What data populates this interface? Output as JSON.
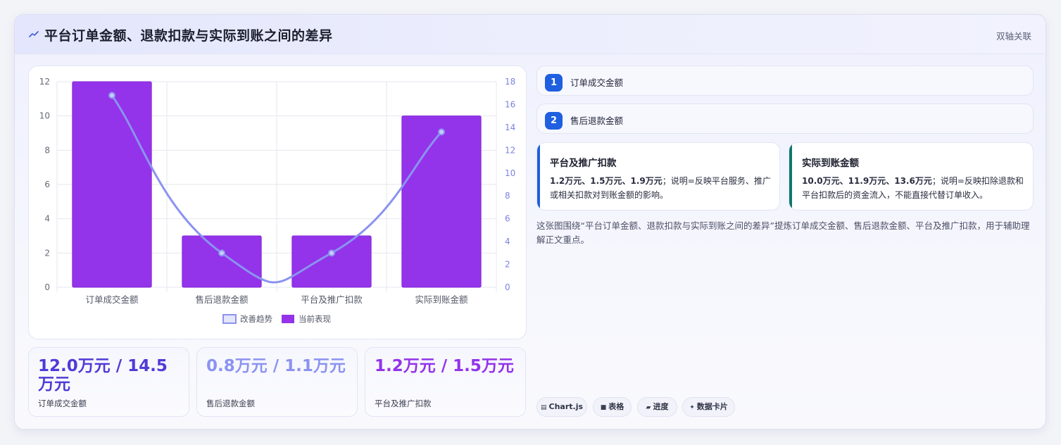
{
  "header": {
    "title": "平台订单金额、退款扣款与实际到账之间的差异",
    "badge": "双轴关联"
  },
  "chart_data": {
    "type": "bar",
    "categories": [
      "订单成交金额",
      "售后退款金额",
      "平台及推广扣款",
      "实际到账金额"
    ],
    "series": [
      {
        "name": "当前表现",
        "type": "bar",
        "axis": "left",
        "color": "#9333ea",
        "values": [
          12.0,
          3.0,
          3.0,
          10.0
        ]
      },
      {
        "name": "改善趋势",
        "type": "line",
        "axis": "right",
        "color": "#8b93f0",
        "values": [
          16.8,
          3.0,
          3.0,
          13.6
        ]
      }
    ],
    "ylim": [
      0,
      12
    ],
    "y_ticks": [
      0,
      2,
      4,
      6,
      8,
      10,
      12
    ],
    "y2lim": [
      0,
      18
    ],
    "y2_ticks": [
      0,
      2,
      4,
      6,
      8,
      10,
      12,
      14,
      16,
      18
    ],
    "grid": true,
    "legend": "bottom"
  },
  "stats": [
    {
      "value": "12.0万元 / 14.5万元",
      "label": "订单成交金额",
      "color": "#4f3bd6"
    },
    {
      "value": "0.8万元 / 1.1万元",
      "label": "售后退款金额",
      "color": "#8b93f0"
    },
    {
      "value": "1.2万元 / 1.5万元",
      "label": "平台及推广扣款",
      "color": "#9333ea"
    }
  ],
  "steps": [
    {
      "num": "1",
      "label": "订单成交金额"
    },
    {
      "num": "2",
      "label": "售后退款金额"
    }
  ],
  "info_cards": [
    {
      "title": "平台及推广扣款",
      "strong": "1.2万元、1.5万元、1.9万元",
      "rest": "；说明=反映平台服务、推广或相关扣款对到账金额的影响。",
      "bar_color": "#1f5fe0"
    },
    {
      "title": "实际到账金额",
      "strong": "10.0万元、11.9万元、13.6万元",
      "rest": "；说明=反映扣除退款和平台扣款后的资金流入，不能直接代替订单收入。",
      "bar_color": "#0f766e"
    }
  ],
  "summary": "这张图围绕“平台订单金额、退款扣款与实际到账之间的差异”提炼订单成交金额、售后退款金额、平台及推广扣款，用于辅助理解正文重点。",
  "tags": [
    {
      "icon": "▤",
      "label": "Chart.js"
    },
    {
      "icon": "■",
      "label": "表格"
    },
    {
      "icon": "▰",
      "label": "进度"
    },
    {
      "icon": "✦",
      "label": "数据卡片"
    }
  ]
}
